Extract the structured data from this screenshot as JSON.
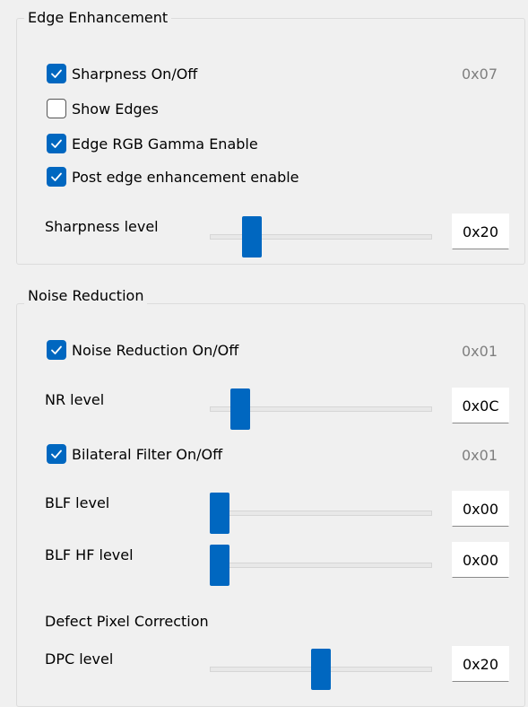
{
  "edge": {
    "title": "Edge Enhancement",
    "sharpness_onoff": {
      "label": "Sharpness On/Off",
      "checked": true,
      "value": "0x07"
    },
    "show_edges": {
      "label": "Show Edges",
      "checked": false
    },
    "rgb_gamma": {
      "label": "Edge RGB Gamma Enable",
      "checked": true
    },
    "post_edge": {
      "label": "Post edge enhancement enable",
      "checked": true
    },
    "sharpness_level": {
      "label": "Sharpness level",
      "value": "0x20",
      "level": 0.16
    }
  },
  "noise": {
    "title": "Noise Reduction",
    "nr_onoff": {
      "label": "Noise Reduction On/Off",
      "checked": true,
      "value": "0x01"
    },
    "nr_level": {
      "label": "NR level",
      "value": "0x0C",
      "level": 0.1
    },
    "blf_onoff": {
      "label": "Bilateral Filter On/Off",
      "checked": true,
      "value": "0x01"
    },
    "blf_level": {
      "label": "BLF level",
      "value": "0x00",
      "level": 0.0
    },
    "blf_hf_level": {
      "label": "BLF HF level",
      "value": "0x00",
      "level": 0.0
    },
    "dpc_title": "Defect Pixel Correction",
    "dpc_level": {
      "label": "DPC level",
      "value": "0x20",
      "level": 0.5
    }
  }
}
